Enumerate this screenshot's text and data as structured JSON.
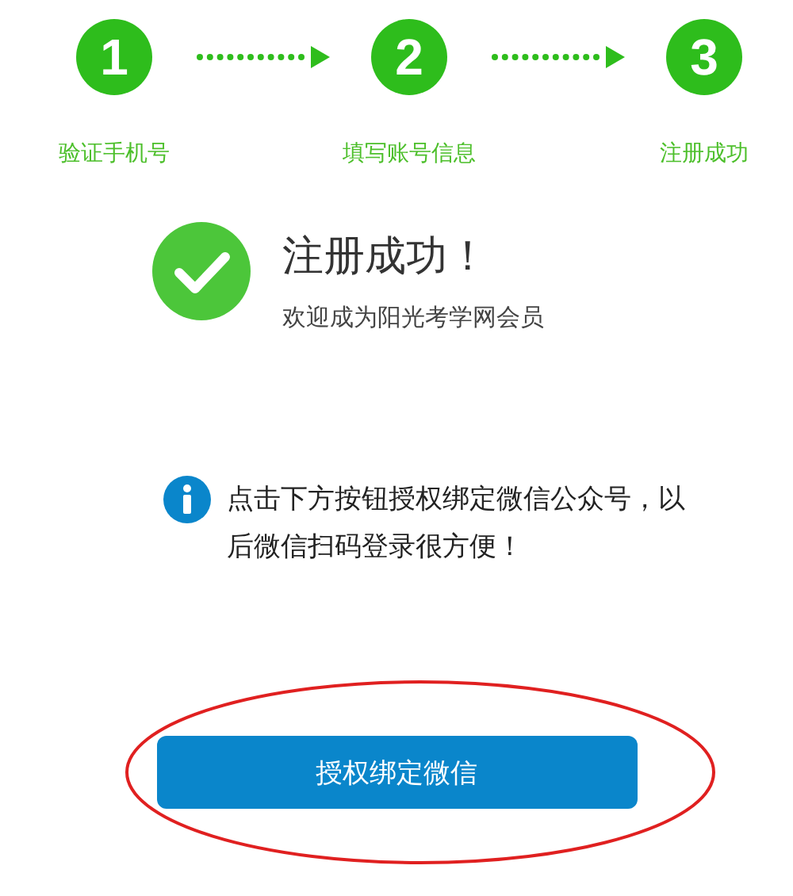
{
  "steps": [
    {
      "number": "1",
      "label": "验证手机号"
    },
    {
      "number": "2",
      "label": "填写账号信息"
    },
    {
      "number": "3",
      "label": "注册成功"
    }
  ],
  "success": {
    "title": "注册成功！",
    "subtitle": "欢迎成为阳光考学网会员"
  },
  "notice": {
    "text": "点击下方按钮授权绑定微信公众号，以后微信扫码登录很方便！"
  },
  "button": {
    "label": "授权绑定微信"
  }
}
